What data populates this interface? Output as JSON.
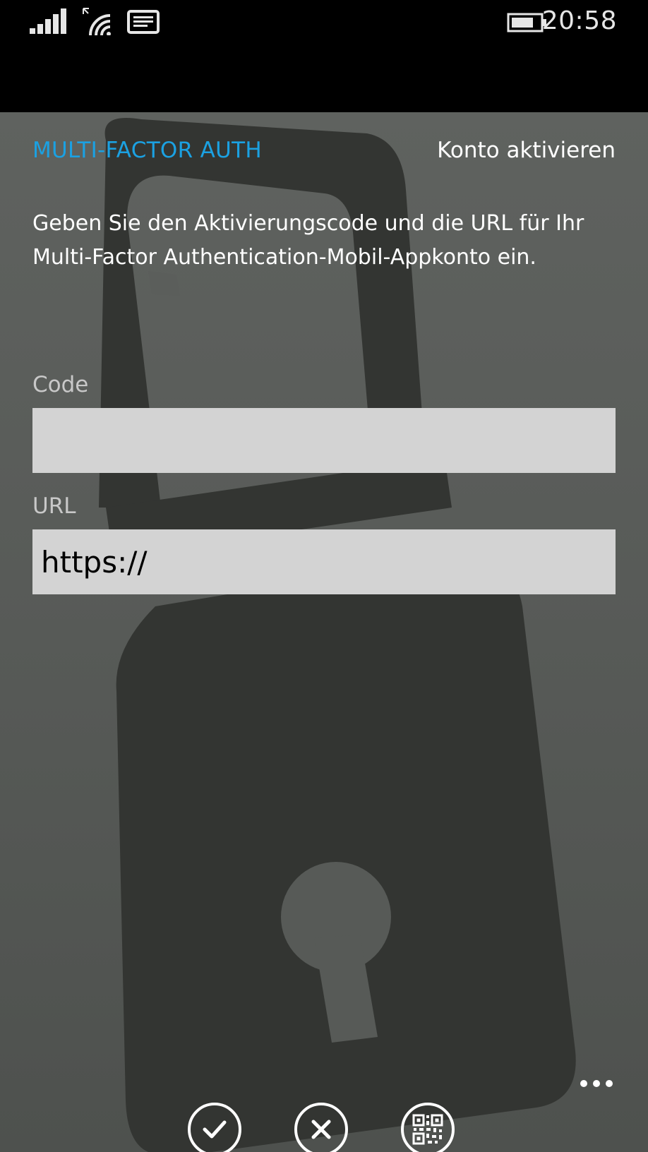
{
  "status_bar": {
    "time": "20:58",
    "icons": [
      "signal-strength-icon",
      "wifi-icon",
      "message-icon",
      "battery-icon"
    ]
  },
  "header": {
    "app_title": "MULTI-FACTOR AUTH",
    "page_title": "Konto aktivieren"
  },
  "instructions": "Geben Sie den Aktivierungscode und die URL für Ihr Multi-Factor Authentication-Mobil-Appkonto ein.",
  "form": {
    "code_label": "Code",
    "code_value": "",
    "url_label": "URL",
    "url_value": "https://"
  },
  "app_bar": {
    "buttons": [
      "check-icon",
      "close-icon",
      "qr-code-icon"
    ],
    "more": "more-icon"
  },
  "colors": {
    "accent": "#1ba1e2",
    "input_bg": "#d3d3d3",
    "lock_shape": "#333532"
  }
}
